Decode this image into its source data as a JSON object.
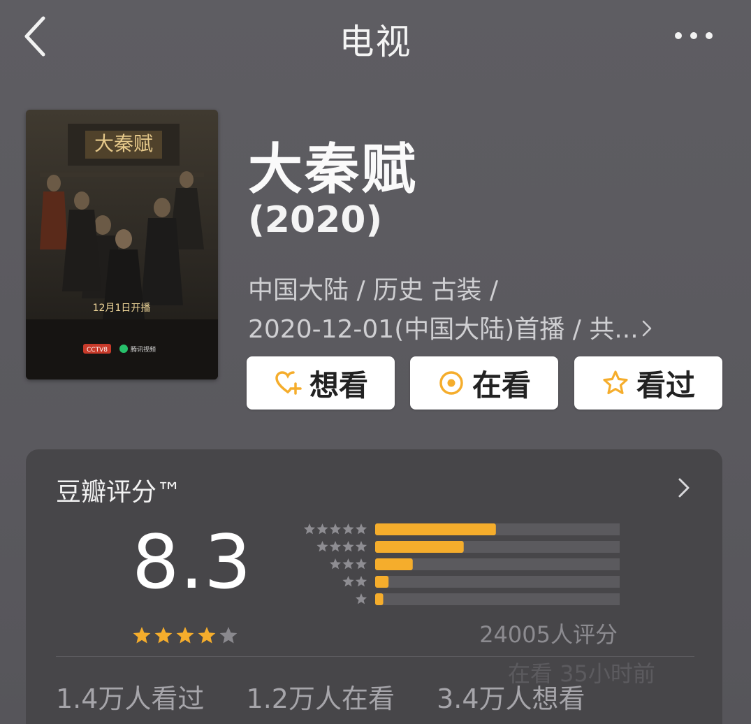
{
  "nav": {
    "title": "电视"
  },
  "poster": {
    "title_text": "大秦赋",
    "air_text": "12月1日开播",
    "logo1": "CCTV8",
    "logo2": "腾讯视频"
  },
  "movie": {
    "title": "大秦赋",
    "year": "(2020)",
    "meta_line1": "中国大陆 / 历史 古装 /",
    "meta_line2": "2020-12-01(中国大陆)首播 / 共..."
  },
  "actions": {
    "want": "想看",
    "watching": "在看",
    "watched": "看过"
  },
  "rating": {
    "title": "豆瓣评分™",
    "score": "8.3",
    "stars": 4,
    "count": "24005人评分",
    "distribution": [
      0.45,
      0.33,
      0.14,
      0.05,
      0.03
    ],
    "watched": "1.4万人看过",
    "watching": "1.2万人在看",
    "wanted": "3.4万人想看",
    "watermark": "在看 35小时前"
  },
  "colors": {
    "accent": "#f5ad2c",
    "bar_bg": "#5b5a5e",
    "background": "#5d5c61",
    "card": "#474649"
  }
}
